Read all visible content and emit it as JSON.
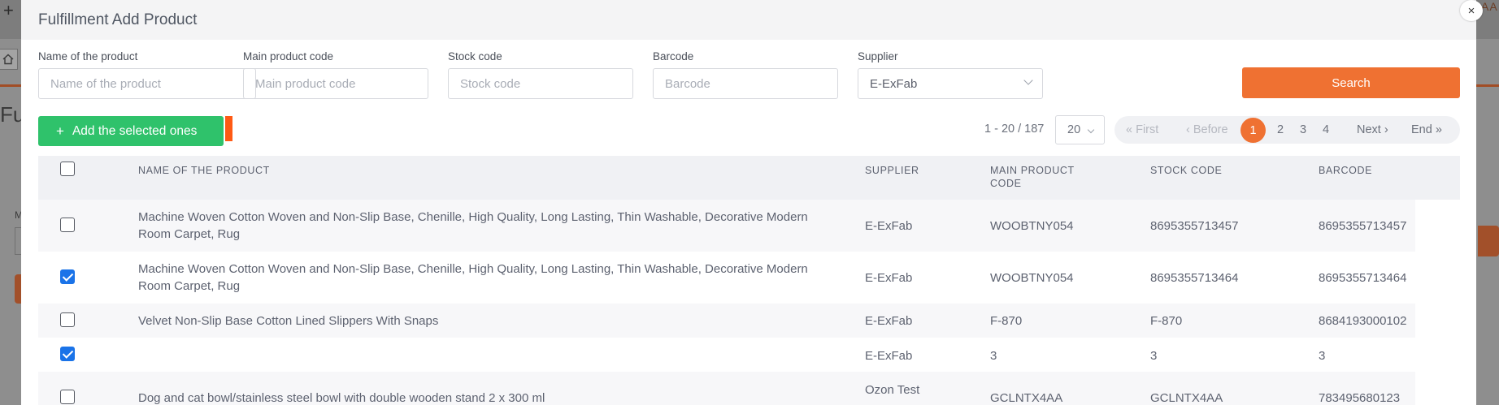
{
  "background": {
    "title_partial": "Ful",
    "label_partial": "M",
    "top_right_partial": "AA"
  },
  "modal": {
    "title": "Fulfillment Add Product",
    "close_label": "×"
  },
  "filters": {
    "product_name": {
      "label": "Name of the product",
      "placeholder": "Name of the product",
      "value": ""
    },
    "main_code": {
      "label": "Main product code",
      "placeholder": "Main product code",
      "value": ""
    },
    "stock_code": {
      "label": "Stock code",
      "placeholder": "Stock code",
      "value": ""
    },
    "barcode": {
      "label": "Barcode",
      "placeholder": "Barcode",
      "value": ""
    },
    "supplier": {
      "label": "Supplier",
      "value": "E-ExFab"
    },
    "search_label": "Search"
  },
  "toolbar": {
    "add_selected_label": "Add the selected ones",
    "range_text": "1 - 20 / 187",
    "per_page": "20"
  },
  "pagination": {
    "first": "« First",
    "before": "‹ Before",
    "pages": [
      "1",
      "2",
      "3",
      "4"
    ],
    "active_page": "1",
    "next": "Next ›",
    "end": "End »"
  },
  "table": {
    "headers": {
      "name": "NAME OF THE PRODUCT",
      "supplier": "SUPPLIER",
      "main_code_line1": "MAIN PRODUCT",
      "main_code_line2": "CODE",
      "stock_code": "STOCK CODE",
      "barcode": "BARCODE"
    },
    "rows": [
      {
        "checked": false,
        "name": "Machine Woven Cotton Woven and Non-Slip Base, Chenille, High Quality, Long Lasting, Thin Washable, Decorative Modern Room Carpet, Rug",
        "supplier": "E-ExFab",
        "main_code": "WOOBTNY054",
        "stock_code": "8695355713457",
        "barcode": "8695355713457"
      },
      {
        "checked": true,
        "name": "Machine Woven Cotton Woven and Non-Slip Base, Chenille, High Quality, Long Lasting, Thin Washable, Decorative Modern Room Carpet, Rug",
        "supplier": "E-ExFab",
        "main_code": "WOOBTNY054",
        "stock_code": "8695355713464",
        "barcode": "8695355713464"
      },
      {
        "checked": false,
        "name": "Velvet Non-Slip Base Cotton Lined Slippers With Snaps",
        "supplier": "E-ExFab",
        "main_code": "F-870",
        "stock_code": "F-870",
        "barcode": "8684193000102"
      },
      {
        "checked": true,
        "name": "",
        "supplier": "E-ExFab",
        "main_code": "3",
        "stock_code": "3",
        "barcode": "3"
      },
      {
        "checked": false,
        "name": "Dog and cat bowl/stainless steel bowl with double wooden stand 2 x 300 ml",
        "supplier": "Ozon Test",
        "main_code": "GCLNTX4AA",
        "stock_code": "GCLNTX4AA",
        "barcode": "783495680123"
      }
    ]
  }
}
